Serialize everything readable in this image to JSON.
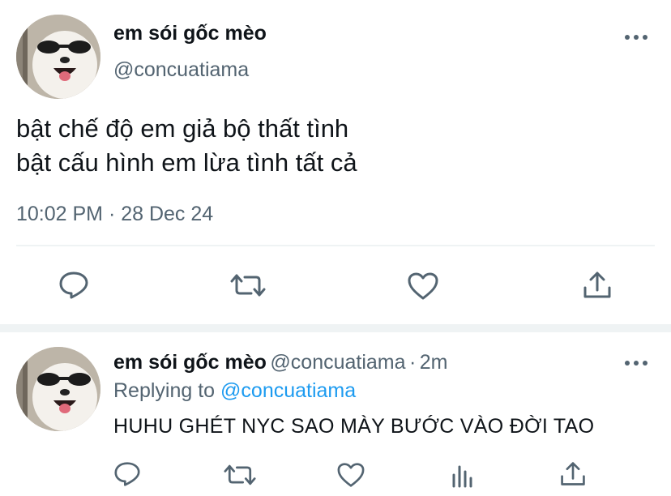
{
  "main_tweet": {
    "display_name": "em sói gốc mèo",
    "handle": "@concuatiama",
    "text_line_1": "bật chế độ em giả bộ thất tình",
    "text_line_2": "bật cấu hình em lừa tình tất cả",
    "timestamp": "10:02 PM · 28 Dec 24",
    "more_icon": "more-horizontal-icon"
  },
  "reply_tweet": {
    "display_name": "em sói gốc mèo",
    "handle": "@concuatiama",
    "separator": "·",
    "age": "2m",
    "replying_prefix": "Replying to",
    "replying_handle": "@concuatiama",
    "text": "HUHU GHÉT NYC SAO MÀY BƯỚC VÀO ĐỜI TAO",
    "more_icon": "more-horizontal-icon"
  },
  "colors": {
    "text": "#0f1419",
    "secondary": "#536471",
    "link": "#1d9bf0",
    "divider": "#eff3f4"
  }
}
